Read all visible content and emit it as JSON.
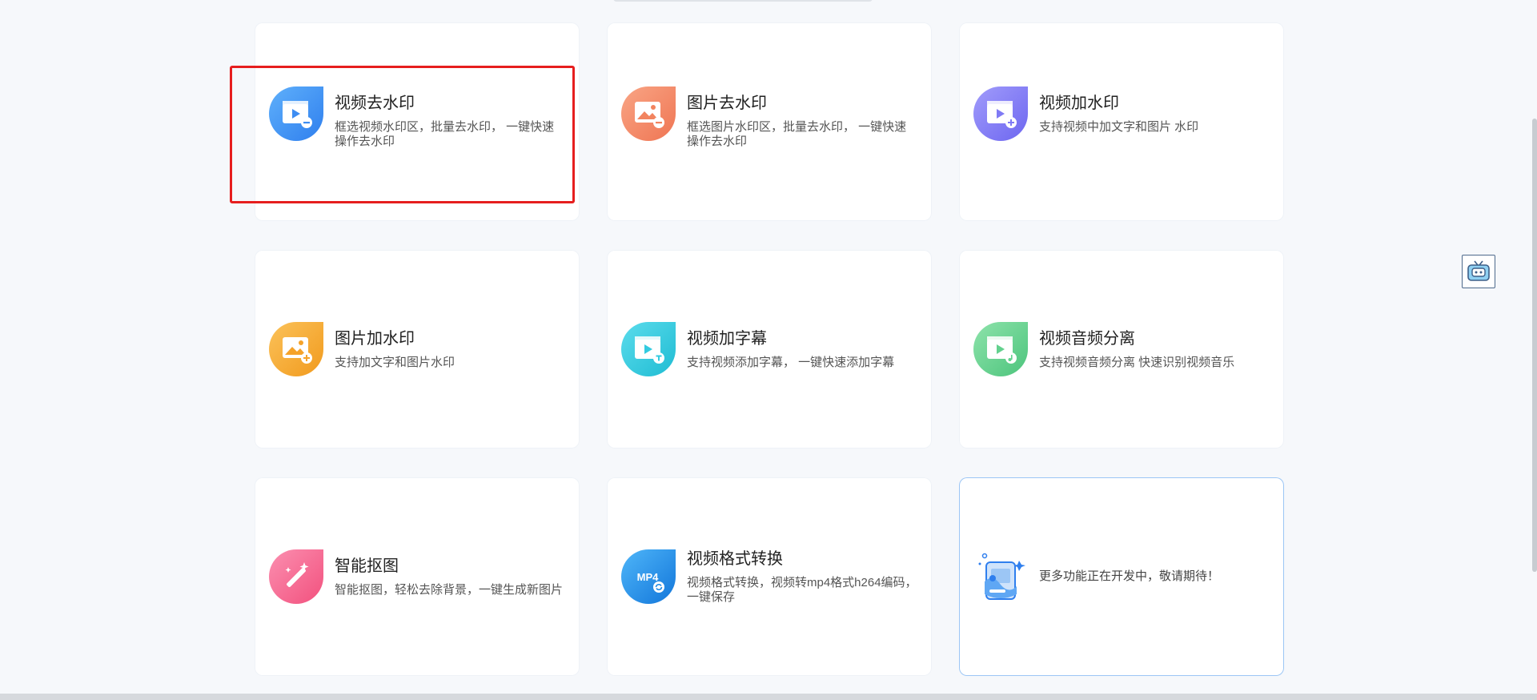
{
  "colors": {
    "highlight": "#e61e1e",
    "blue": "#3d8df2",
    "orange": "#f2845f",
    "purple": "#7f7af5",
    "amber": "#f5a32a",
    "cyan": "#33cbe0",
    "green": "#63d18e",
    "pink": "#f7628a",
    "deepblue": "#1f8be6"
  },
  "cards": [
    {
      "title": "视频去水印",
      "desc": "框选视频水印区，批量去水印， 一键快速操作去水印",
      "icon": "video-remove-watermark-icon"
    },
    {
      "title": "图片去水印",
      "desc": "框选图片水印区，批量去水印， 一键快速操作去水印",
      "icon": "image-remove-watermark-icon"
    },
    {
      "title": "视频加水印",
      "desc": "支持视频中加文字和图片 水印",
      "icon": "video-add-watermark-icon"
    },
    {
      "title": "图片加水印",
      "desc": "支持加文字和图片水印",
      "icon": "image-add-watermark-icon"
    },
    {
      "title": "视频加字幕",
      "desc": "支持视频添加字幕， 一键快速添加字幕",
      "icon": "video-subtitle-icon"
    },
    {
      "title": "视频音频分离",
      "desc": "支持视频音频分离 快速识别视频音乐",
      "icon": "video-audio-separate-icon"
    },
    {
      "title": "智能抠图",
      "desc": "智能抠图，轻松去除背景，一键生成新图片",
      "icon": "magic-wand-icon"
    },
    {
      "title": "视频格式转换",
      "desc": "视频格式转换，视频转mp4格式h264编码，一键保存",
      "icon": "mp4-convert-icon",
      "badge": "MP4"
    },
    {
      "title": "",
      "desc": "更多功能正在开发中，敬请期待！",
      "icon": "coming-soon-illustration-icon"
    }
  ],
  "side_widget": {
    "icon": "tv-robot-icon"
  }
}
